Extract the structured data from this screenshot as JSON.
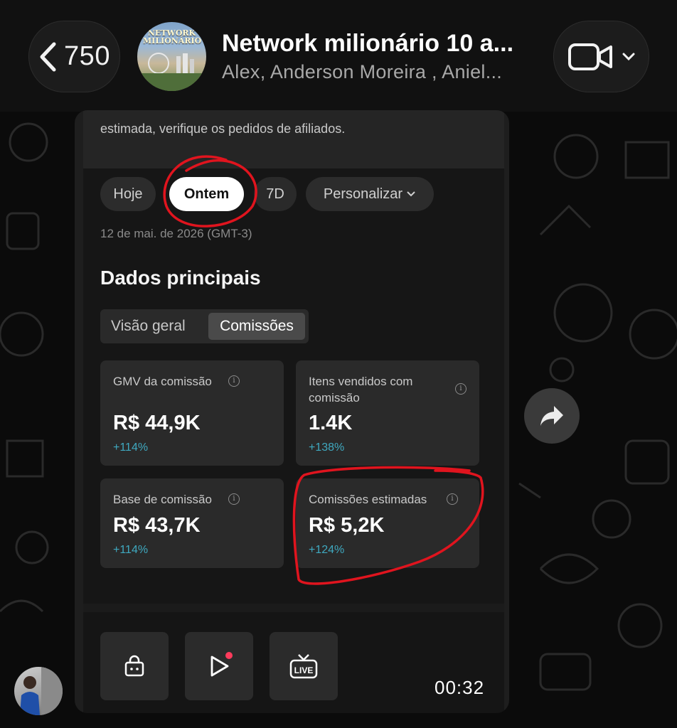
{
  "header": {
    "back_count": "750",
    "group_title": "Network milionário 10 a...",
    "group_members": "Alex, Anderson Moreira , Aniel...",
    "avatar_logo_text": "NETWORK MILIONÁRIO"
  },
  "screenshot": {
    "description": "estimada, verifique os pedidos de afiliados.",
    "filters": [
      {
        "label": "Hoje",
        "active": false
      },
      {
        "label": "Ontem",
        "active": true
      },
      {
        "label": "7D",
        "active": false
      },
      {
        "label": "Personalizar",
        "active": false
      }
    ],
    "date": "12 de mai. de 2026 (GMT-3)",
    "section_title": "Dados principais",
    "tabs": [
      {
        "label": "Visão geral",
        "active": false
      },
      {
        "label": "Comissões",
        "active": true
      }
    ],
    "metrics": [
      {
        "label": "GMV da comissão",
        "value": "R$ 44,9K",
        "change": "+114%"
      },
      {
        "label": "Itens vendidos com comissão",
        "value": "1.4K",
        "change": "+138%"
      },
      {
        "label": "Base de comissão",
        "value": "R$ 43,7K",
        "change": "+114%"
      },
      {
        "label": "Comissões estimadas",
        "value": "R$ 5,2K",
        "change": "+124%"
      }
    ],
    "live_label": "LIVE"
  },
  "video": {
    "duration": "00:32"
  },
  "colors": {
    "annotation_red": "#e0141e",
    "change_teal": "#3fa9c0"
  },
  "icons": [
    "chevron-left-icon",
    "video-camera-icon",
    "chevron-down-icon",
    "shopping-bag-icon",
    "play-icon",
    "live-tv-icon",
    "forward-icon",
    "info-icon"
  ]
}
